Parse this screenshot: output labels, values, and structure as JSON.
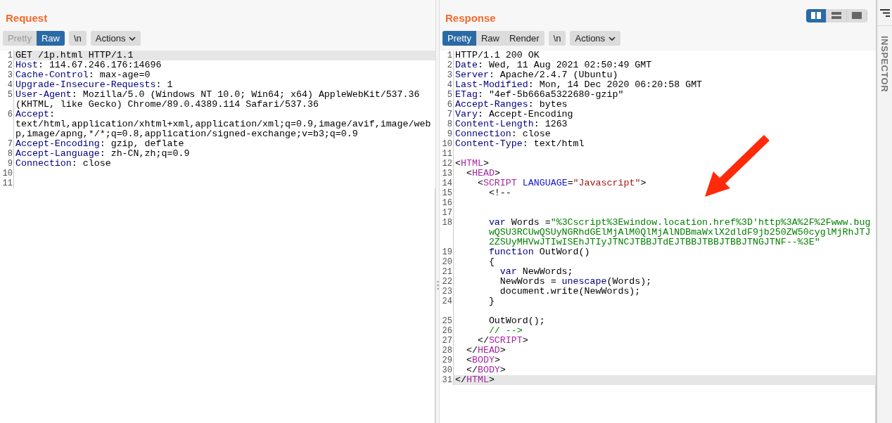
{
  "layout_toggles": [
    {
      "selected": true
    },
    {
      "selected": false
    },
    {
      "selected": false
    }
  ],
  "panes": [
    {
      "title": "Request",
      "view_tabs": [
        {
          "label": "Pretty",
          "selected": false
        },
        {
          "label": "Raw",
          "selected": true
        }
      ],
      "newline_button": "\\n",
      "actions_button": "Actions",
      "rows": [
        {
          "number": "1",
          "highlighted": true,
          "segments": [
            {
              "kind": "plain",
              "text": "GET /1p.html HTTP/1.1"
            }
          ]
        },
        {
          "number": "2",
          "highlighted": false,
          "segments": [
            {
              "kind": "name",
              "text": "Host"
            },
            {
              "kind": "plain",
              "text": ": 114.67.246.176:14696"
            }
          ]
        },
        {
          "number": "3",
          "highlighted": false,
          "segments": [
            {
              "kind": "name",
              "text": "Cache-Control"
            },
            {
              "kind": "plain",
              "text": ": max-age=0"
            }
          ]
        },
        {
          "number": "4",
          "highlighted": false,
          "segments": [
            {
              "kind": "name",
              "text": "Upgrade-Insecure-Requests"
            },
            {
              "kind": "plain",
              "text": ": 1"
            }
          ]
        },
        {
          "number": "5",
          "highlighted": false,
          "segments": [
            {
              "kind": "name",
              "text": "User-Agent"
            },
            {
              "kind": "plain",
              "text": ": Mozilla/5.0 (Windows NT 10.0; Win64; x64) AppleWebKit/537.36"
            }
          ]
        },
        {
          "highlighted": false,
          "segments": [
            {
              "kind": "plain",
              "text": "(KHTML, like Gecko) Chrome/89.0.4389.114 Safari/537.36"
            }
          ]
        },
        {
          "number": "6",
          "highlighted": false,
          "segments": [
            {
              "kind": "name",
              "text": "Accept"
            },
            {
              "kind": "plain",
              "text": ":"
            }
          ]
        },
        {
          "highlighted": false,
          "segments": [
            {
              "kind": "plain",
              "text": "text/html,application/xhtml+xml,application/xml;q=0.9,image/avif,image/web"
            }
          ]
        },
        {
          "highlighted": false,
          "segments": [
            {
              "kind": "plain",
              "text": "p,image/apng,*/*;q=0.8,application/signed-exchange;v=b3;q=0.9"
            }
          ]
        },
        {
          "number": "7",
          "highlighted": false,
          "segments": [
            {
              "kind": "name",
              "text": "Accept-Encoding"
            },
            {
              "kind": "plain",
              "text": ": gzip, deflate"
            }
          ]
        },
        {
          "number": "8",
          "highlighted": false,
          "segments": [
            {
              "kind": "name",
              "text": "Accept-Language"
            },
            {
              "kind": "plain",
              "text": ": zh-CN,zh;q=0.9"
            }
          ]
        },
        {
          "number": "9",
          "highlighted": false,
          "segments": [
            {
              "kind": "name",
              "text": "Connection"
            },
            {
              "kind": "plain",
              "text": ": close"
            }
          ]
        },
        {
          "number": "10",
          "highlighted": false,
          "segments": []
        },
        {
          "number": "11",
          "highlighted": false,
          "segments": []
        }
      ]
    },
    {
      "title": "Response",
      "view_tabs": [
        {
          "label": "Pretty",
          "selected": true
        },
        {
          "label": "Raw",
          "selected": false
        },
        {
          "label": "Render",
          "selected": false
        }
      ],
      "newline_button": "\\n",
      "actions_button": "Actions",
      "rows": [
        {
          "number": "1",
          "highlighted": false,
          "segments": [
            {
              "kind": "plain",
              "text": "HTTP/1.1 200 OK"
            }
          ]
        },
        {
          "number": "2",
          "highlighted": false,
          "segments": [
            {
              "kind": "name",
              "text": "Date"
            },
            {
              "kind": "plain",
              "text": ": Wed, 11 Aug 2021 02:50:49 GMT"
            }
          ]
        },
        {
          "number": "3",
          "highlighted": false,
          "segments": [
            {
              "kind": "name",
              "text": "Server"
            },
            {
              "kind": "plain",
              "text": ": Apache/2.4.7 (Ubuntu)"
            }
          ]
        },
        {
          "number": "4",
          "highlighted": false,
          "segments": [
            {
              "kind": "name",
              "text": "Last-Modified"
            },
            {
              "kind": "plain",
              "text": ": Mon, 14 Dec 2020 06:20:58 GMT"
            }
          ]
        },
        {
          "number": "5",
          "highlighted": false,
          "segments": [
            {
              "kind": "name",
              "text": "ETag"
            },
            {
              "kind": "plain",
              "text": ": \"4ef-5b666a5322680-gzip\""
            }
          ]
        },
        {
          "number": "6",
          "highlighted": false,
          "segments": [
            {
              "kind": "name",
              "text": "Accept-Ranges"
            },
            {
              "kind": "plain",
              "text": ": bytes"
            }
          ]
        },
        {
          "number": "7",
          "highlighted": false,
          "segments": [
            {
              "kind": "name",
              "text": "Vary"
            },
            {
              "kind": "plain",
              "text": ": Accept-Encoding"
            }
          ]
        },
        {
          "number": "8",
          "highlighted": false,
          "segments": [
            {
              "kind": "name",
              "text": "Content-Length"
            },
            {
              "kind": "plain",
              "text": ": 1263"
            }
          ]
        },
        {
          "number": "9",
          "highlighted": false,
          "segments": [
            {
              "kind": "name",
              "text": "Connection"
            },
            {
              "kind": "plain",
              "text": ": close"
            }
          ]
        },
        {
          "number": "10",
          "highlighted": false,
          "segments": [
            {
              "kind": "name",
              "text": "Content-Type"
            },
            {
              "kind": "plain",
              "text": ": text/html"
            }
          ]
        },
        {
          "number": "11",
          "highlighted": false,
          "segments": []
        },
        {
          "number": "12",
          "highlighted": false,
          "segments": [
            {
              "kind": "plain",
              "text": "<"
            },
            {
              "kind": "tag",
              "text": "HTML"
            },
            {
              "kind": "plain",
              "text": ">"
            }
          ]
        },
        {
          "number": "13",
          "highlighted": false,
          "segments": [
            {
              "kind": "plain",
              "text": "  <"
            },
            {
              "kind": "tag",
              "text": "HEAD"
            },
            {
              "kind": "plain",
              "text": ">"
            }
          ]
        },
        {
          "number": "14",
          "highlighted": false,
          "segments": [
            {
              "kind": "plain",
              "text": "    <"
            },
            {
              "kind": "tag",
              "text": "SCRIPT"
            },
            {
              "kind": "attr",
              "text": " LANGUAGE"
            },
            {
              "kind": "plain",
              "text": "="
            },
            {
              "kind": "string",
              "text": "\"Javascript\""
            },
            {
              "kind": "plain",
              "text": ">"
            }
          ]
        },
        {
          "number": "15",
          "highlighted": false,
          "segments": [
            {
              "kind": "plain",
              "text": "      <!--"
            }
          ]
        },
        {
          "number": "16",
          "highlighted": false,
          "segments": []
        },
        {
          "number": "17",
          "highlighted": false,
          "segments": []
        },
        {
          "number": "18",
          "highlighted": false,
          "segments": [
            {
              "kind": "keyword",
              "text": "      var"
            },
            {
              "kind": "plain",
              "text": " Words ="
            },
            {
              "kind": "jsstring",
              "text": "\"%3Cscript%3Ewindow.location.href%3D'http%3A%2F%2Fwww.bug"
            }
          ]
        },
        {
          "highlighted": false,
          "segments": [
            {
              "kind": "jsstring",
              "text": "      wQSU3RCUwQSUyNGRhdGElMjAlM0QlMjAlNDBmaWxlX2dldF9jb250ZW50cyglMjRhJTJ"
            }
          ]
        },
        {
          "highlighted": false,
          "segments": [
            {
              "kind": "jsstring",
              "text": "      2ZSUyMHVwJTIwISEhJTIyJTNCJTBBJTdEJTBBJTBBJTBBJTNGJTNF--%3E\""
            }
          ]
        },
        {
          "number": "19",
          "highlighted": false,
          "segments": [
            {
              "kind": "keyword",
              "text": "      function"
            },
            {
              "kind": "plain",
              "text": " OutWord()"
            }
          ]
        },
        {
          "number": "20",
          "highlighted": false,
          "segments": [
            {
              "kind": "plain",
              "text": "      {"
            }
          ]
        },
        {
          "number": "21",
          "highlighted": false,
          "segments": [
            {
              "kind": "keyword",
              "text": "        var"
            },
            {
              "kind": "plain",
              "text": " NewWords;"
            }
          ]
        },
        {
          "number": "22",
          "highlighted": false,
          "segments": [
            {
              "kind": "plain",
              "text": "        NewWords = "
            },
            {
              "kind": "builtin",
              "text": "unescape"
            },
            {
              "kind": "plain",
              "text": "(Words);"
            }
          ]
        },
        {
          "number": "23",
          "highlighted": false,
          "segments": [
            {
              "kind": "plain",
              "text": "        document.write(NewWords);"
            }
          ]
        },
        {
          "number": "24",
          "highlighted": false,
          "segments": [
            {
              "kind": "plain",
              "text": "      }"
            }
          ]
        },
        {
          "highlighted": false,
          "segments": []
        },
        {
          "number": "25",
          "highlighted": false,
          "segments": [
            {
              "kind": "plain",
              "text": "      OutWord();"
            }
          ]
        },
        {
          "number": "26",
          "highlighted": false,
          "segments": [
            {
              "kind": "comment",
              "text": "      // -->"
            }
          ]
        },
        {
          "number": "27",
          "highlighted": false,
          "segments": [
            {
              "kind": "plain",
              "text": "    </"
            },
            {
              "kind": "tag",
              "text": "SCRIPT"
            },
            {
              "kind": "plain",
              "text": ">"
            }
          ]
        },
        {
          "number": "28",
          "highlighted": false,
          "segments": [
            {
              "kind": "plain",
              "text": "  </"
            },
            {
              "kind": "tag",
              "text": "HEAD"
            },
            {
              "kind": "plain",
              "text": ">"
            }
          ]
        },
        {
          "number": "29",
          "highlighted": false,
          "segments": [
            {
              "kind": "plain",
              "text": "  <"
            },
            {
              "kind": "tag",
              "text": "BODY"
            },
            {
              "kind": "plain",
              "text": ">"
            }
          ]
        },
        {
          "number": "30",
          "highlighted": false,
          "segments": [
            {
              "kind": "plain",
              "text": "  </"
            },
            {
              "kind": "tag",
              "text": "BODY"
            },
            {
              "kind": "plain",
              "text": ">"
            }
          ]
        },
        {
          "number": "31",
          "highlighted": true,
          "segments": [
            {
              "kind": "plain",
              "text": "</"
            },
            {
              "kind": "tag",
              "text": "HTML"
            },
            {
              "kind": "plain",
              "text": ">"
            }
          ]
        }
      ]
    }
  ],
  "inspector": {
    "label": "INSPECTOR"
  }
}
